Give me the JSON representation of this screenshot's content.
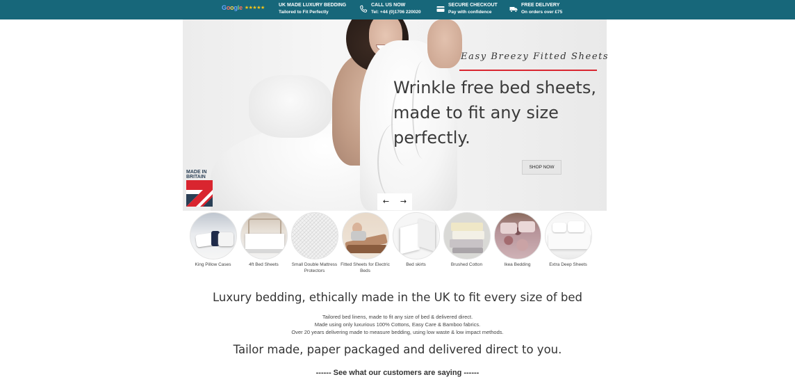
{
  "topbar": {
    "google": {
      "logo_text": "Google",
      "stars": "★★★★★"
    },
    "items": [
      {
        "title": "UK MADE LUXURY BEDDING",
        "subtitle": "Tailored to Fit Perfectly",
        "icon": "none"
      },
      {
        "title": "CALL US NOW",
        "subtitle": "Tel: +44 (0)1706 220020",
        "icon": "phone-icon"
      },
      {
        "title": "SECURE CHECKOUT",
        "subtitle": "Pay with confidence",
        "icon": "credit-card-icon"
      },
      {
        "title": "FREE DELIVERY",
        "subtitle": "On orders over £75",
        "icon": "truck-icon"
      }
    ],
    "background": "#17677a"
  },
  "hero": {
    "tagline": "Easy Breezy Fitted Sheets",
    "headline": "Wrinkle free bed sheets, made to fit any size perfectly.",
    "cta": "SHOP NOW",
    "accent_color": "#d9252f",
    "badge": {
      "line1": "MADE IN",
      "line2": "BRITAIN"
    },
    "prev_arrow": "←",
    "next_arrow": "→"
  },
  "categories": [
    {
      "label": "King Pillow Cases"
    },
    {
      "label": "4ft Bed Sheets"
    },
    {
      "label": "Small Double Mattress Protectors"
    },
    {
      "label": "Fitted Sheets for Electric Beds"
    },
    {
      "label": "Bed skirts"
    },
    {
      "label": "Brushed Cotton"
    },
    {
      "label": "Ikea Bedding"
    },
    {
      "label": "Extra Deep Sheets"
    }
  ],
  "intro": {
    "heading": "Luxury bedding, ethically made in the UK to fit every size of bed",
    "lines": [
      "Tailored bed linens, made to fit any size of bed & delivered direct.",
      "Made using only luxurious 100% Cottons, Easy Care & Bamboo fabrics.",
      "Over 20 years delivering made to measure bedding, using low waste & low impact methods."
    ],
    "tailor": "Tailor made, paper packaged and delivered direct to you.",
    "customers": "------ See what our customers are saying ------"
  }
}
